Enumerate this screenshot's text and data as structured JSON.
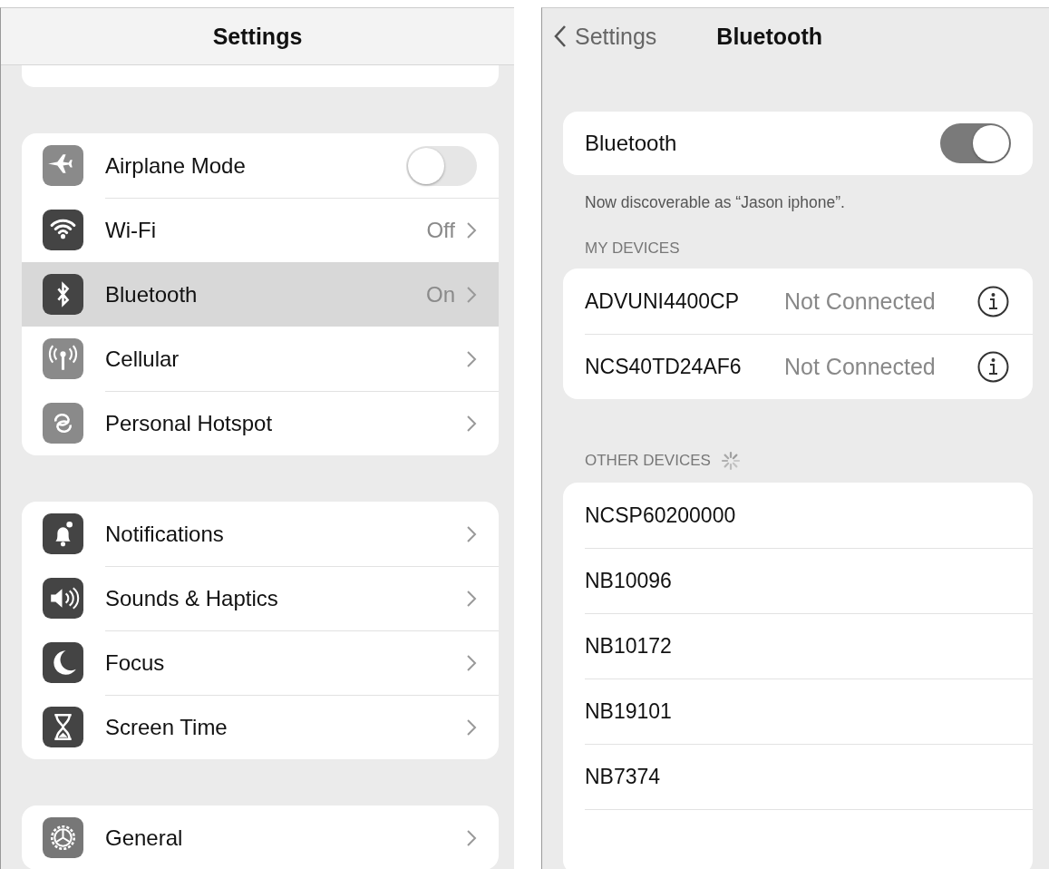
{
  "settings": {
    "title": "Settings",
    "groups": [
      {
        "items": [
          {
            "label": "Airplane Mode",
            "kind": "toggle",
            "on": false,
            "selected": false
          },
          {
            "label": "Wi-Fi",
            "kind": "link",
            "value": "Off",
            "selected": false
          },
          {
            "label": "Bluetooth",
            "kind": "link",
            "value": "On",
            "selected": true
          },
          {
            "label": "Cellular",
            "kind": "link",
            "selected": false
          },
          {
            "label": "Personal Hotspot",
            "kind": "link",
            "selected": false
          }
        ]
      },
      {
        "items": [
          {
            "label": "Notifications",
            "kind": "link",
            "selected": false
          },
          {
            "label": "Sounds & Haptics",
            "kind": "link",
            "selected": false
          },
          {
            "label": "Focus",
            "kind": "link",
            "selected": false
          },
          {
            "label": "Screen Time",
            "kind": "link",
            "selected": false
          }
        ]
      },
      {
        "items": [
          {
            "label": "General",
            "kind": "link",
            "selected": false
          }
        ]
      }
    ]
  },
  "bluetooth": {
    "back": "Settings",
    "title": "Bluetooth",
    "toggle": {
      "label": "Bluetooth",
      "on": true
    },
    "note": "Now discoverable as “Jason iphone”.",
    "my_devices": {
      "header": "MY DEVICES",
      "devices": [
        {
          "name": "ADVUNI4400CP",
          "status": "Not Connected"
        },
        {
          "name": "NCS40TD24AF6",
          "status": "Not Connected"
        }
      ]
    },
    "other_devices": {
      "header": "OTHER DEVICES",
      "searching": true,
      "devices": [
        {
          "name": "NCSP60200000"
        },
        {
          "name": "NB10096"
        },
        {
          "name": "NB10172"
        },
        {
          "name": "NB19101"
        },
        {
          "name": "NB7374"
        }
      ]
    }
  }
}
